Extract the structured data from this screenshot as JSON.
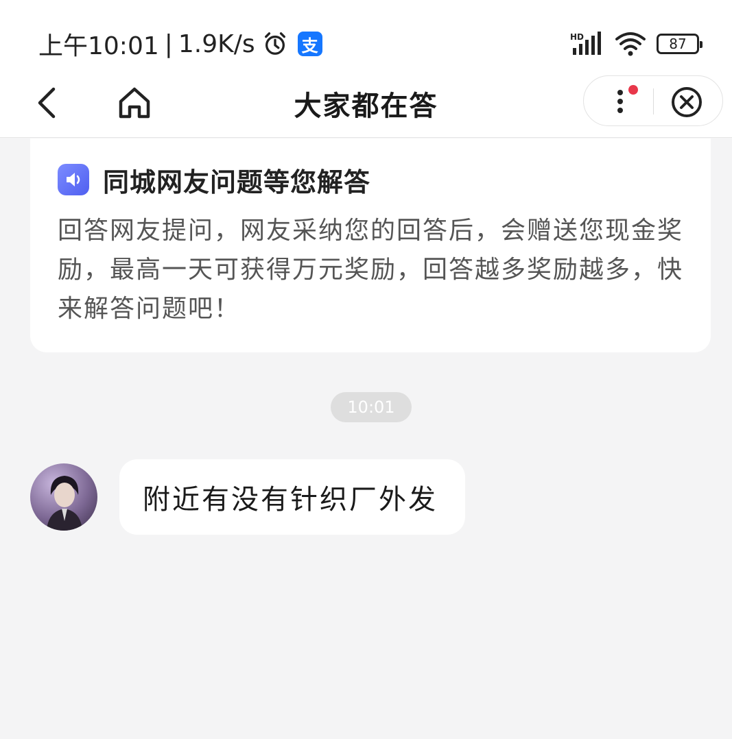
{
  "status_bar": {
    "time": "上午10:01",
    "separator": "|",
    "network_speed": "1.9K/s",
    "app_icon_glyph": "支",
    "signal_label": "HD",
    "battery": "87",
    "icons": [
      "alarm-icon",
      "alipay-icon",
      "signal-icon",
      "wifi-icon",
      "battery-icon"
    ]
  },
  "nav": {
    "title": "大家都在答",
    "icons": [
      "back-icon",
      "home-icon",
      "more-icon",
      "close-icon"
    ],
    "notification_dot_color": "#e8374a"
  },
  "notice": {
    "title": "同城网友问题等您解答",
    "body": "回答网友提问，网友采纳您的回答后，会赠送您现金奖励，最高一天可获得万元奖励，回答越多奖励越多，快来解答问题吧！",
    "icon": "speaker-icon"
  },
  "chat": {
    "timestamp": "10:01",
    "messages": [
      {
        "text": "附近有没有针织厂外发",
        "avatar": "user-avatar"
      }
    ]
  },
  "colors": {
    "background": "#f4f4f5",
    "card": "#ffffff",
    "accent": "#4f5ff0",
    "alipay_blue": "#1677ff"
  }
}
